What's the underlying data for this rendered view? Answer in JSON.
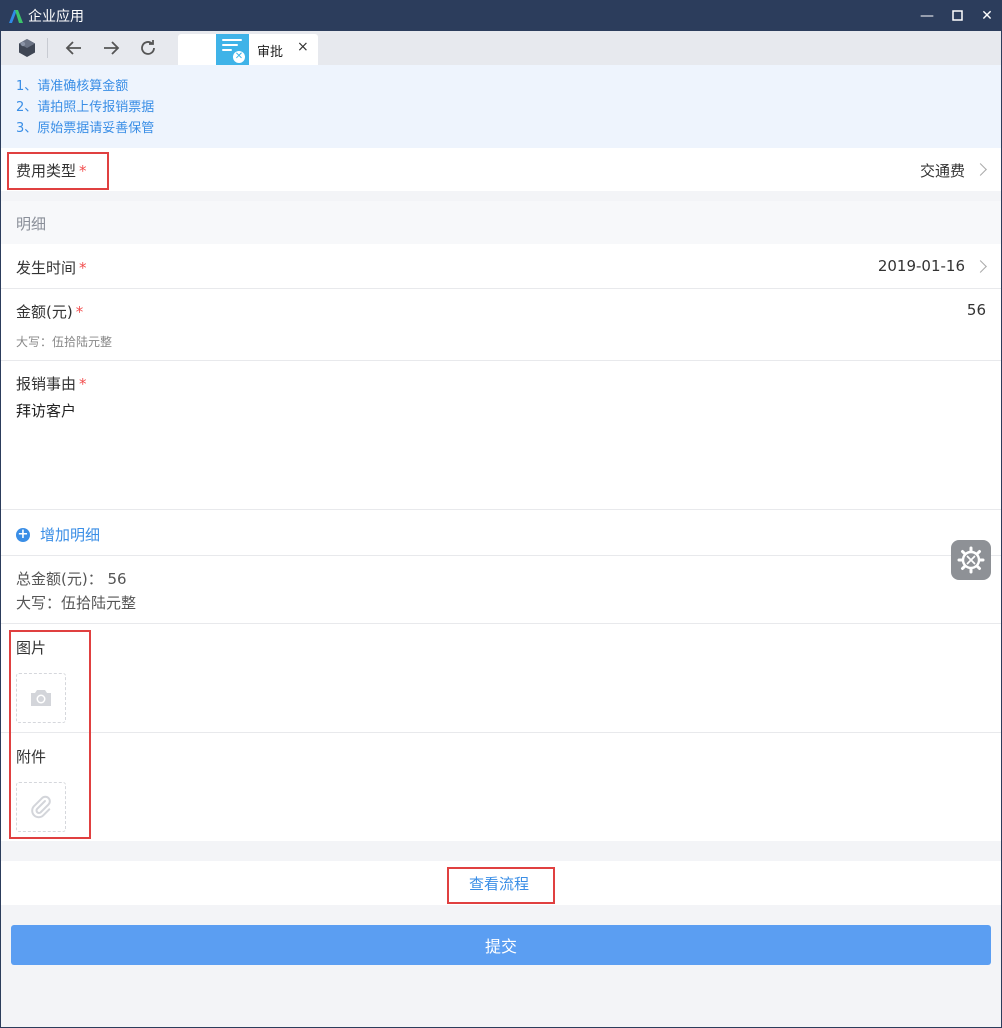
{
  "window": {
    "title": "企业应用",
    "minimize": "—",
    "maximize": "☐",
    "close": "✕"
  },
  "toolbar": {
    "tab_label": "审批",
    "tab_close": "×"
  },
  "notice": [
    "1、请准确核算金额",
    "2、请拍照上传报销票据",
    "3、原始票据请妥善保管"
  ],
  "form": {
    "expense_type_label": "费用类型",
    "expense_type_value": "交通费",
    "required_mark": "*",
    "detail_section_title": "明细",
    "date_label": "发生时间",
    "date_value": "2019-01-16",
    "amount_label": "金额(元)",
    "amount_value": "56",
    "amount_uppercase_small": "大写：伍拾陆元整",
    "reason_label": "报销事由",
    "reason_value": "拜访客户",
    "add_detail_label": "增加明细",
    "total_label": "总金额(元)：",
    "total_value": "56",
    "total_uppercase": "大写：伍拾陆元整",
    "image_label": "图片",
    "attachment_label": "附件"
  },
  "actions": {
    "view_flow_label": "查看流程",
    "submit_label": "提交"
  },
  "colors": {
    "titlebar": "#2c3d5c",
    "accent": "#3a8ee6",
    "submit": "#5b9ef2",
    "required": "#f24e4e",
    "highlight_box": "#e04040"
  }
}
